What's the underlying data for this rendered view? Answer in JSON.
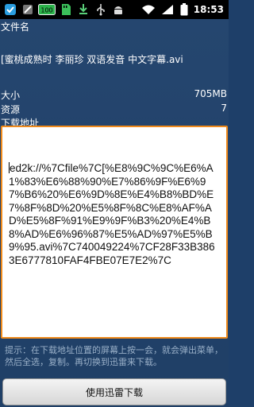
{
  "status_bar": {
    "time": "18:53",
    "battery_chip": "100"
  },
  "labels": {
    "filename_label": "文件名",
    "filename_value": "[蜜桃成熟时 李丽珍 双语发音 中文字幕.avi",
    "size_label": "大小",
    "size_value": "705MB",
    "resource_label": "资源",
    "resource_value": "7",
    "download_label": "下载地址"
  },
  "download_link": "ed2k://%7Cfile%7C[%E8%9C%9C%E6%A1%83%E6%88%90%E7%86%9F%E6%97%B6%20%E6%9D%8E%E4%B8%BD%E7%8F%8D%20%E5%8F%8C%E8%AF%AD%E5%8F%91%E9%9F%B3%20%E4%B8%AD%E6%96%87%E5%AD%97%E5%B9%95.avi%7C740049224%7CF28F33B3863E6777810FAF4FBE07E7E2%7C",
  "hint": "提示：在下载地址位置的屏幕上按一会，就会弹出菜单，然后全选，复制。再切换到迅雷来下载。",
  "button_label": "使用迅雷下载"
}
